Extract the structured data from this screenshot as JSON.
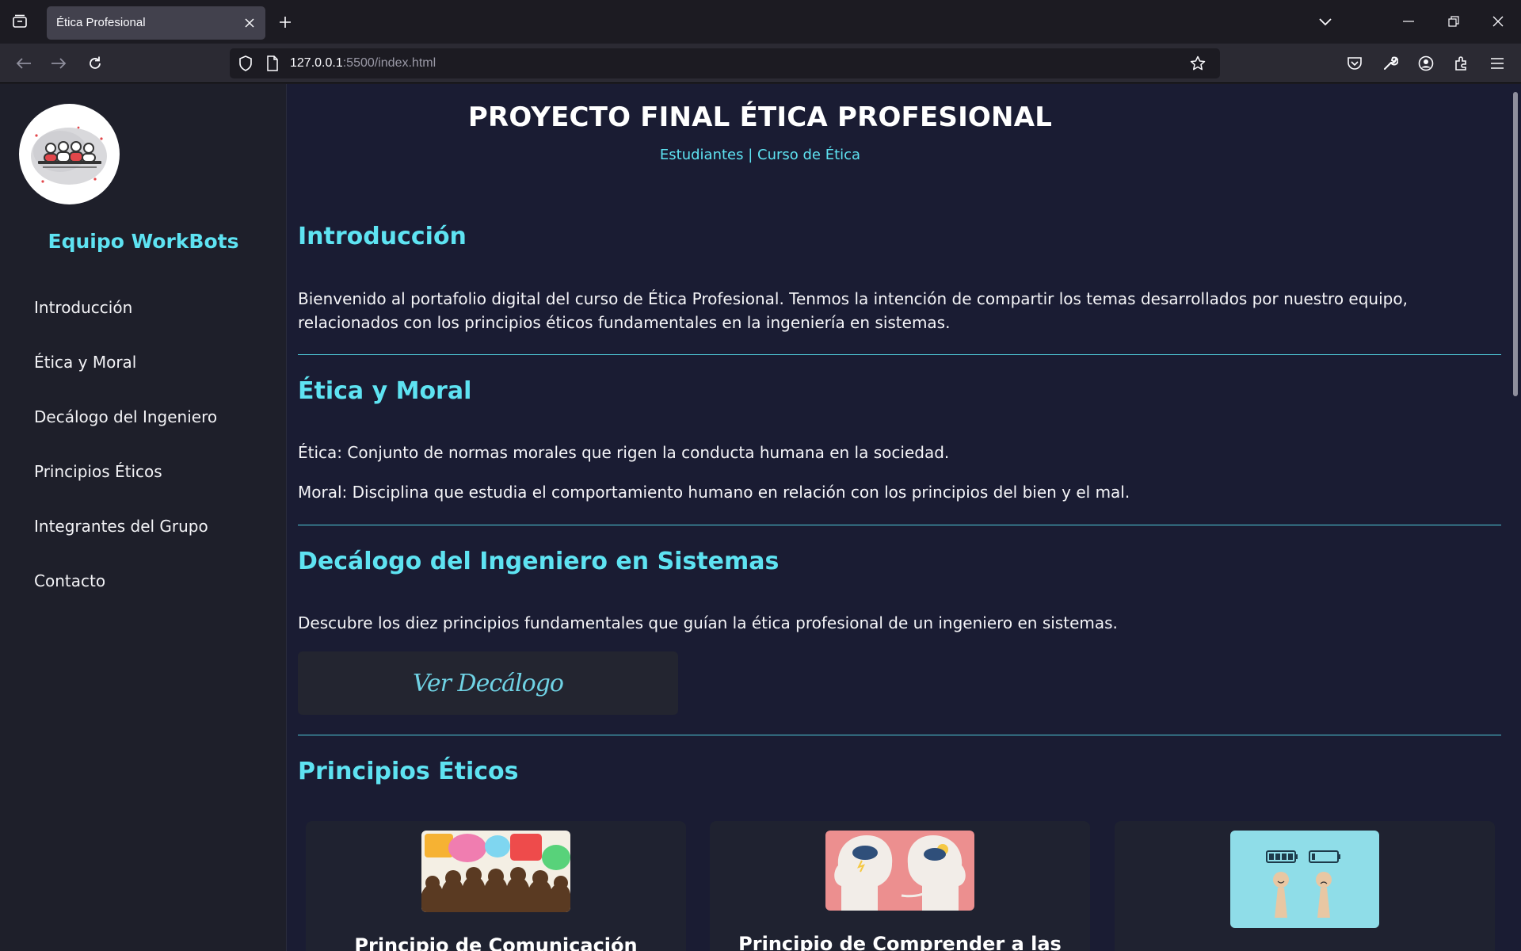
{
  "browser": {
    "tab_title": "Ética Profesional",
    "url_host": "127.0.0.1",
    "url_rest": ":5500/index.html"
  },
  "sidebar": {
    "team_name": "Equipo WorkBots",
    "items": [
      {
        "label": "Introducción"
      },
      {
        "label": "Ética y Moral"
      },
      {
        "label": "Decálogo del Ingeniero"
      },
      {
        "label": "Principios Éticos"
      },
      {
        "label": "Integrantes del Grupo"
      },
      {
        "label": "Contacto"
      }
    ]
  },
  "header": {
    "title": "PROYECTO FINAL ÉTICA PROFESIONAL",
    "subtitle": "Estudiantes | Curso de Ética"
  },
  "intro": {
    "heading": "Introducción",
    "text": "Bienvenido al portafolio digital del curso de Ética Profesional. Tenmos la intención de compartir los temas desarrollados por nuestro equipo, relacionados con los principios éticos fundamentales en la ingeniería en sistemas."
  },
  "etica": {
    "heading": "Ética y Moral",
    "etica_text": "Ética: Conjunto de normas morales que rigen la conducta humana en la sociedad.",
    "moral_text": "Moral: Disciplina que estudia el comportamiento humano en relación con los principios del bien y el mal."
  },
  "decalogo": {
    "heading": "Decálogo del Ingeniero en Sistemas",
    "text": "Descubre los diez principios fundamentales que guían la ética profesional de un ingeniero en sistemas.",
    "button_label": "Ver Decálogo"
  },
  "principios": {
    "heading": "Principios Éticos",
    "cards": [
      {
        "title": "Principio de Comunicación"
      },
      {
        "title": "Principio de Comprender a las"
      },
      {
        "title": ""
      }
    ]
  },
  "colors": {
    "accent": "#5ee3f2",
    "page_bg": "#1a1c33",
    "sidebar_bg": "#1e1f2a"
  }
}
